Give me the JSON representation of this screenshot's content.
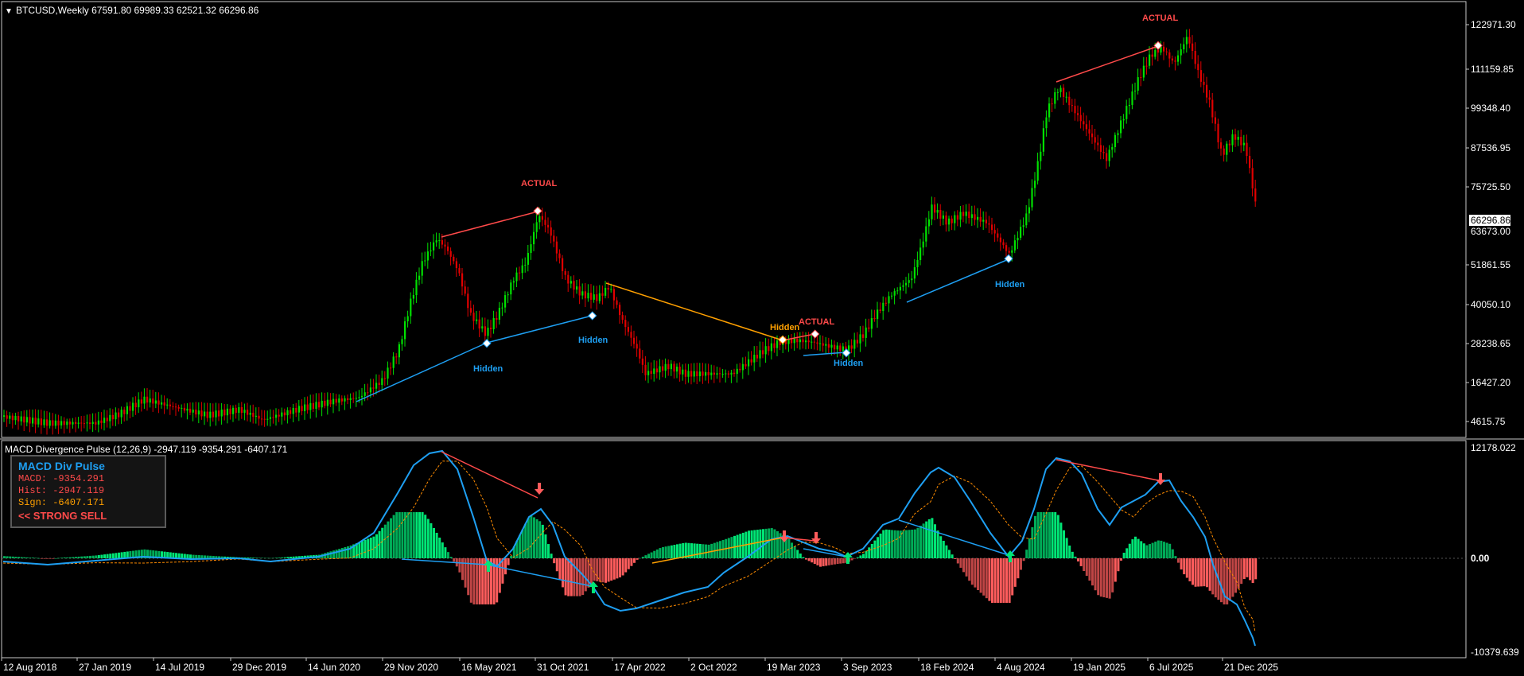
{
  "header": {
    "menu_arrow": "▼",
    "title": "BTCUSD,Weekly  67591.80 69989.33 62521.32 66296.86"
  },
  "indicator_header": {
    "title": "MACD Divergence Pulse (12,26,9) -2947.119 -9354.291 -6407.171"
  },
  "price_axis": {
    "ticks": [
      "122971.30",
      "111159.85",
      "99348.40",
      "87536.95",
      "75725.50",
      "63673.00",
      "51861.55",
      "40050.10",
      "28238.65",
      "16427.20",
      "4615.75"
    ],
    "current": "66296.86"
  },
  "macd_axis": {
    "ticks": [
      "12178.022",
      "0.00",
      "-10379.639"
    ]
  },
  "time_axis": {
    "ticks": [
      "12 Aug 2018",
      "27 Jan 2019",
      "14 Jul 2019",
      "29 Dec 2019",
      "14 Jun 2020",
      "29 Nov 2020",
      "16 May 2021",
      "31 Oct 2021",
      "17 Apr 2022",
      "2 Oct 2022",
      "19 Mar 2023",
      "3 Sep 2023",
      "18 Feb 2024",
      "4 Aug 2024",
      "19 Jan 2025",
      "6 Jul 2025",
      "21 Dec 2025"
    ]
  },
  "labels": {
    "actual_1": "ACTUAL",
    "actual_2": "ACTUAL",
    "actual_3": "ACTUAL",
    "hidden_1": "Hidden",
    "hidden_2": "Hidden",
    "hidden_3": "Hidden",
    "hidden_4": "Hidden",
    "hidden_orange": "Hidden"
  },
  "panel": {
    "title": "MACD Div Pulse",
    "macd": "MACD: -9354.291",
    "hist": "Hist: -2947.119",
    "sign": "Sign: -6407.171",
    "signal_text": "<< STRONG SELL"
  },
  "colors": {
    "bull": "#00e000",
    "bear": "#e00000",
    "macd_line": "#1e9ff2",
    "signal_line": "#ff8c00",
    "hist_pos": "#00e676",
    "hist_neg": "#ff5c5c",
    "bearish_div": "#ff4a4a",
    "bullish_div": "#1e9ff2",
    "hidden_div": "#ffa000"
  }
}
